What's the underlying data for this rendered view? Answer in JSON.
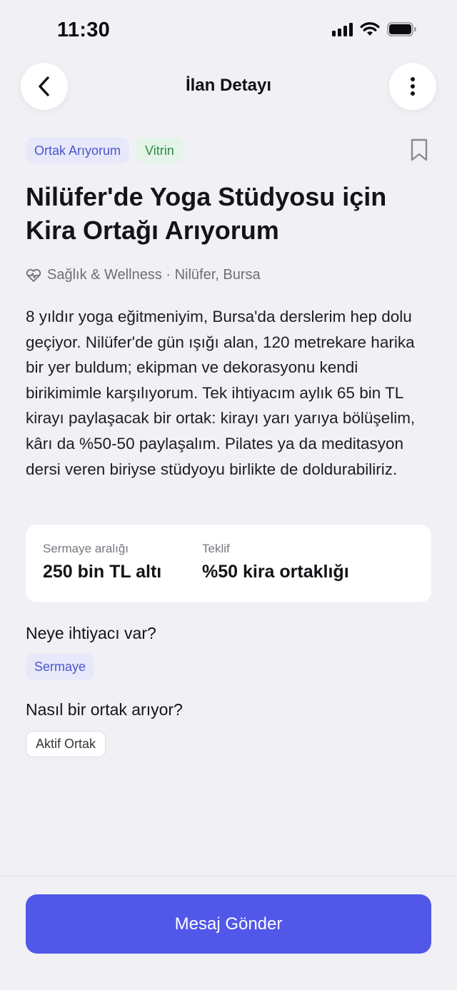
{
  "status_bar": {
    "time": "11:30",
    "icons": [
      "cellular-signal-icon",
      "wifi-icon",
      "battery-icon"
    ]
  },
  "nav": {
    "title": "İlan Detayı",
    "back_icon": "chevron-left-icon",
    "more_icon": "vertical-ellipsis-icon"
  },
  "tags": [
    {
      "label": "Ortak Arıyorum",
      "color": "#4a55c9"
    },
    {
      "label": "Vitrin",
      "color": "#2e8a45"
    }
  ],
  "bookmark_icon": "bookmark-icon",
  "listing": {
    "title": "Nilüfer'de Yoga Stüdyosu için Kira Ortağı Arıyorum",
    "category_icon": "heart-pulse-icon",
    "meta": "Sağlık & Wellness · Nilüfer, Bursa",
    "description": "8 yıldır yoga eğitmeniyim, Bursa'da derslerim hep dolu geçiyor. Nilüfer'de gün ışığı alan, 120 metrekare harika bir yer buldum; ekipman ve dekorasyonu kendi birikimimle karşılıyorum. Tek ihtiyacım aylık 65 bin TL kirayı paylaşacak bir ortak: kirayı yarı yarıya bölüşelim, kârı da %50-50 paylaşalım. Pilates ya da meditasyon dersi veren biriyse stüdyoyu birlikte de doldurabiliriz."
  },
  "summary": {
    "capital_label": "Sermaye aralığı",
    "capital_value": "250 bin TL altı",
    "offer_label": "Teklif",
    "offer_value": "%50 kira ortaklığı"
  },
  "needs": {
    "heading": "Neye ihtiyacı var?",
    "items": [
      "Sermaye"
    ]
  },
  "partner_type": {
    "heading": "Nasıl bir ortak arıyor?",
    "items": [
      "Aktif Ortak"
    ]
  },
  "cta": {
    "label": "Mesaj Gönder",
    "color": "#5157e8"
  }
}
